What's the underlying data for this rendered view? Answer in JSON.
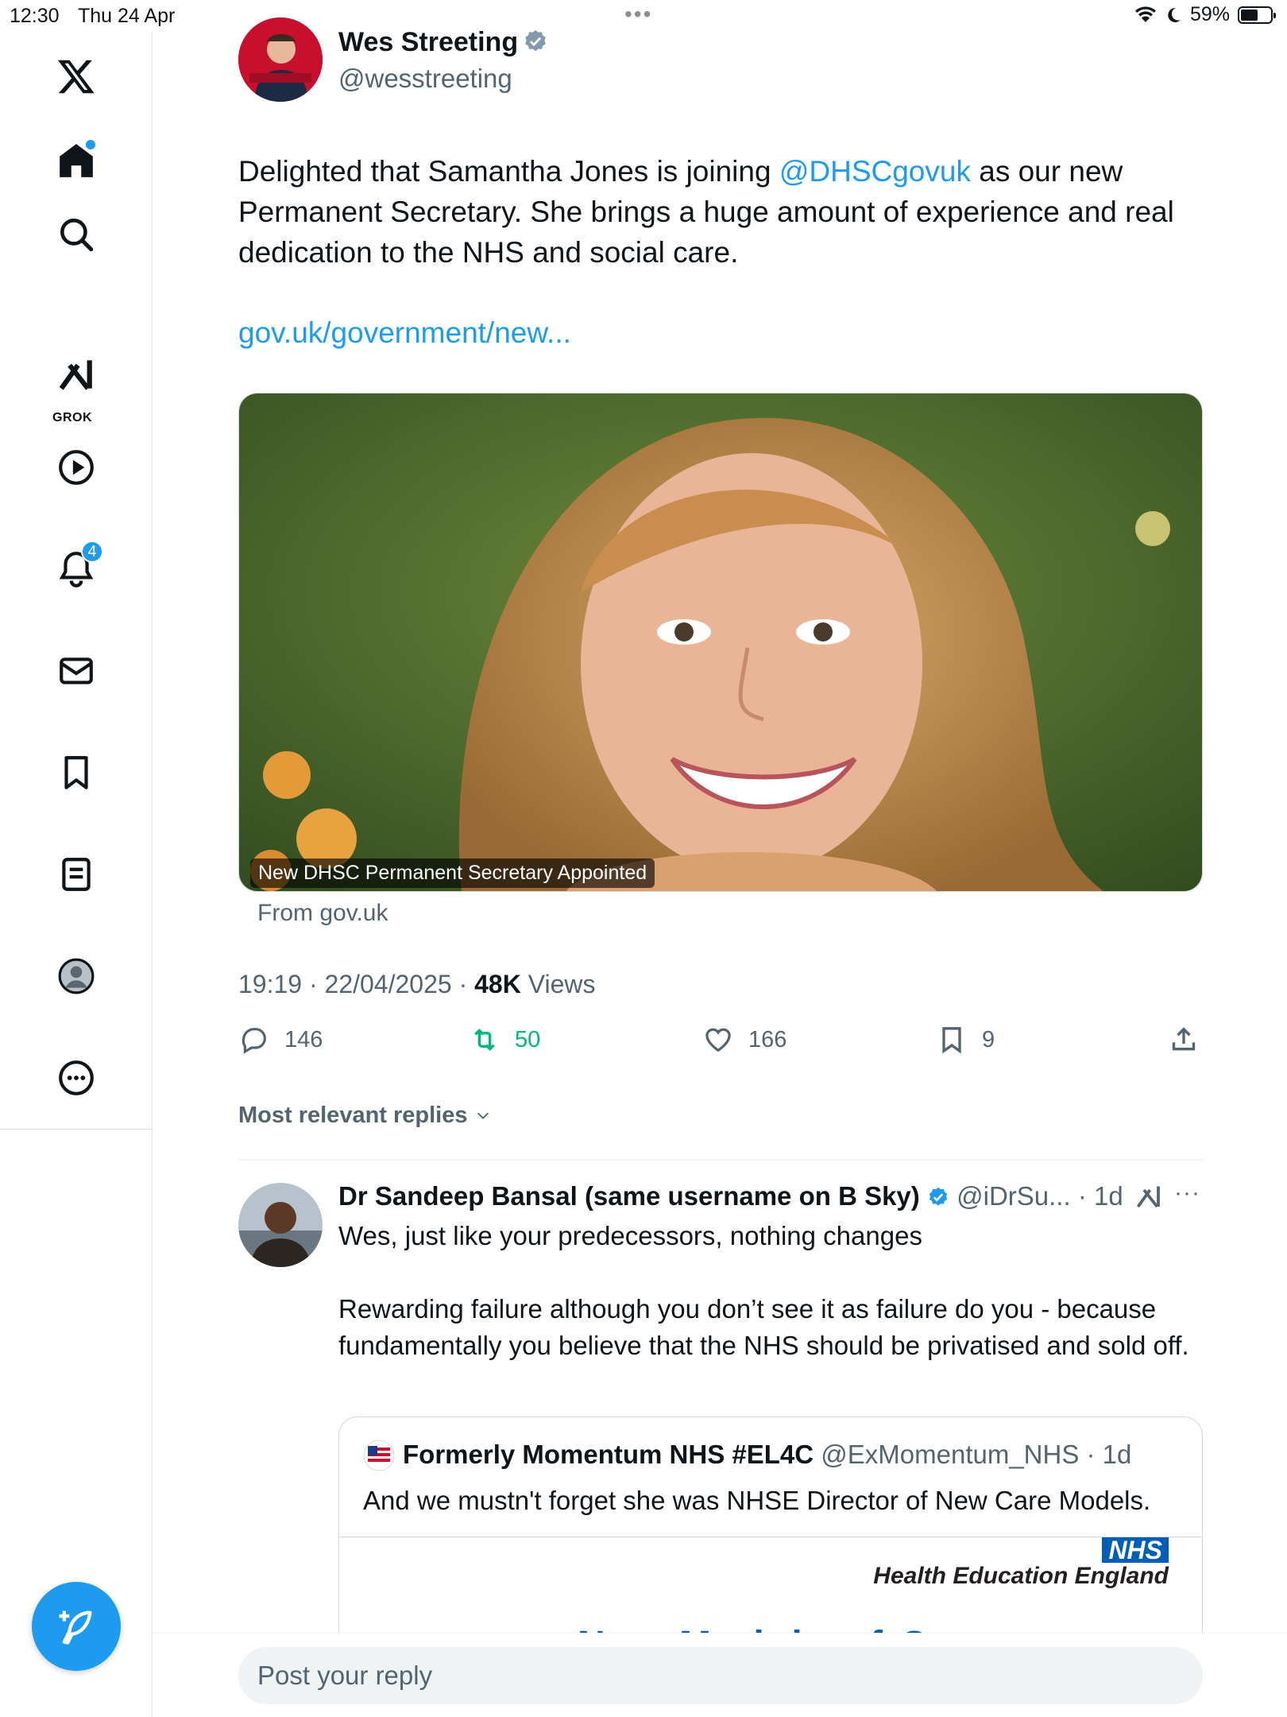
{
  "status_bar": {
    "time": "12:30",
    "date": "Thu 24 Apr",
    "battery": "59%"
  },
  "sidebar": {
    "grok_label": "GROK",
    "notifications_badge": "4",
    "items": [
      {
        "icon": "x-logo-icon"
      },
      {
        "icon": "home-icon"
      },
      {
        "icon": "search-icon"
      },
      {
        "icon": "grok-icon"
      },
      {
        "icon": "video-play-icon"
      },
      {
        "icon": "bell-icon"
      },
      {
        "icon": "mail-icon"
      },
      {
        "icon": "bookmark-icon"
      },
      {
        "icon": "lists-icon"
      },
      {
        "icon": "profile-icon"
      },
      {
        "icon": "more-icon"
      }
    ]
  },
  "tweet": {
    "author_name": "Wes Streeting",
    "author_handle": "@wesstreeting",
    "text_before": "Delighted that Samantha Jones is joining ",
    "mention": "@DHSCgovuk",
    "text_after": " as our new Permanent Secretary. She brings a huge amount of experience and real dedication to the NHS and social care.",
    "link": "gov.uk/government/new...",
    "card_caption": "New DHSC Permanent Secretary Appointed",
    "card_source": "From gov.uk",
    "timestamp": "19:19 · 22/04/2025 · ",
    "views_count": "48K",
    "views_label": " Views",
    "replies": "146",
    "retweets": "50",
    "likes": "166",
    "bookmarks": "9"
  },
  "replies_filter": "Most relevant replies",
  "reply": {
    "name": "Dr Sandeep Bansal (same username on B Sky)",
    "handle_time": "@iDrSu... · 1d",
    "text": "Wes, just like your predecessors, nothing changes\n\nRewarding failure although you don’t see it as failure do you - because fundamentally you believe that the NHS should be privatised and sold off.",
    "quote": {
      "name": "Formerly Momentum NHS #EL4C",
      "handle_time": "@ExMomentum_NHS · 1d",
      "text": "And we mustn't forget she was NHSE Director of New Care Models.",
      "media_logo": "NHS",
      "media_org": "Health Education England",
      "media_title": "New Models of C..."
    }
  },
  "reply_box": {
    "placeholder": "Post your reply"
  },
  "colors": {
    "accent": "#1d9bf0",
    "retweet_green": "#00ba7c",
    "muted": "#536471",
    "text": "#0f1419"
  }
}
